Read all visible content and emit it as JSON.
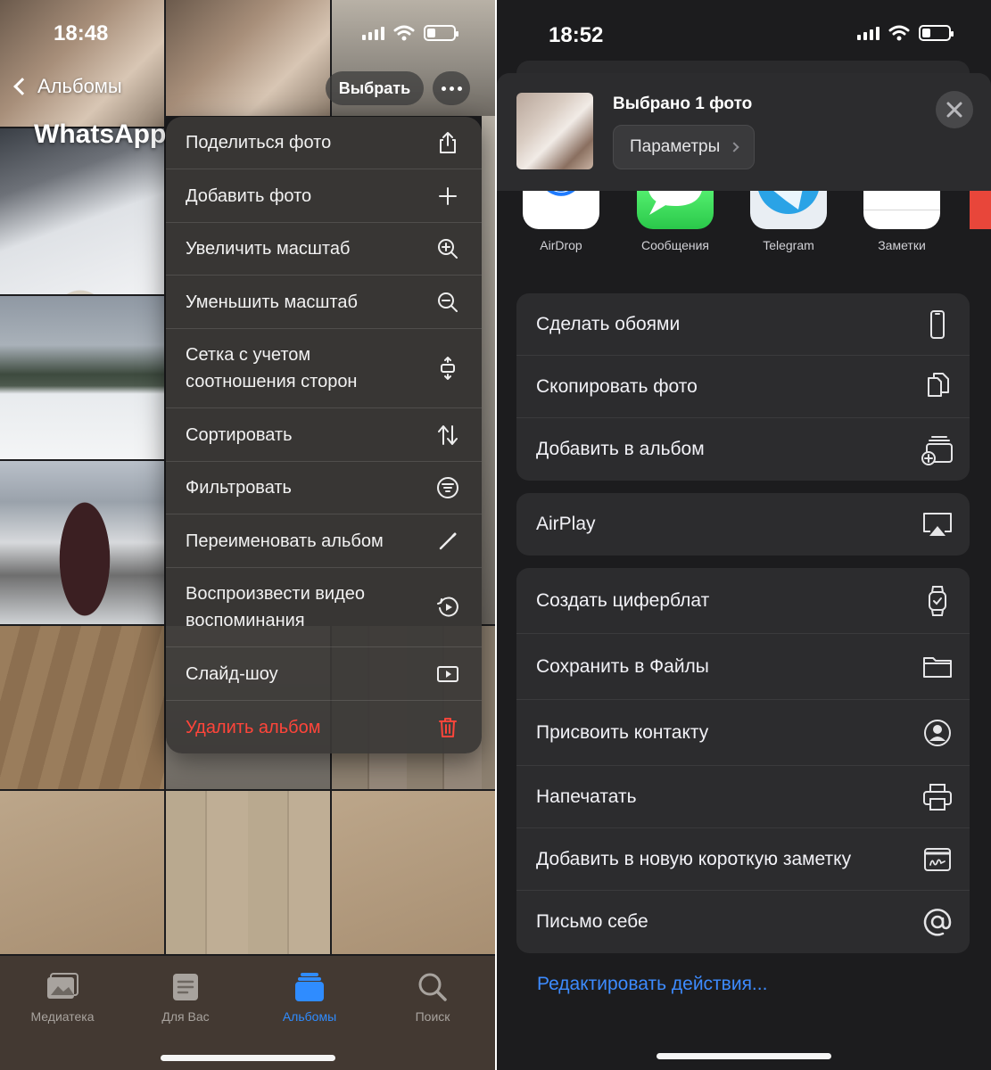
{
  "left": {
    "status": {
      "time": "18:48"
    },
    "nav": {
      "back_label": "Альбомы",
      "select_label": "Выбрать"
    },
    "album_title": "WhatsApp",
    "menu": [
      {
        "label": "Поделиться фото",
        "icon": "share-icon"
      },
      {
        "label": "Добавить фото",
        "icon": "plus-icon"
      },
      {
        "label": "Увеличить масштаб",
        "icon": "zoom-in-icon"
      },
      {
        "label": "Уменьшить масштаб",
        "icon": "zoom-out-icon"
      },
      {
        "label_line1": "Сетка с учетом",
        "label_line2": "соотношения сторон",
        "icon": "aspect-grid-icon"
      },
      {
        "label": "Сортировать",
        "icon": "sort-icon"
      },
      {
        "label": "Фильтровать",
        "icon": "filter-icon"
      },
      {
        "label": "Переименовать альбом",
        "icon": "pencil-icon"
      },
      {
        "label_line1": "Воспроизвести видео",
        "label_line2": "воспоминания",
        "icon": "memories-play-icon"
      },
      {
        "label": "Слайд-шоу",
        "icon": "slideshow-icon"
      },
      {
        "label": "Удалить альбом",
        "icon": "trash-icon",
        "color": "#ff453a"
      }
    ],
    "tabs": [
      {
        "label": "Медиатека",
        "icon": "library-icon",
        "active": false
      },
      {
        "label": "Для Вас",
        "icon": "for-you-icon",
        "active": false
      },
      {
        "label": "Альбомы",
        "icon": "albums-icon",
        "active": true
      },
      {
        "label": "Поиск",
        "icon": "search-icon",
        "active": false
      }
    ],
    "accent_color": "#2f8cff"
  },
  "right": {
    "status": {
      "time": "18:52"
    },
    "header": {
      "title": "Выбрано 1 фото",
      "params_label": "Параметры"
    },
    "apps": [
      {
        "label": "AirDrop",
        "icon": "airdrop-icon"
      },
      {
        "label": "Сообщения",
        "icon": "messages-icon"
      },
      {
        "label": "Telegram",
        "icon": "telegram-icon"
      },
      {
        "label": "Заметки",
        "icon": "notes-icon"
      }
    ],
    "group1": [
      {
        "label": "Сделать обоями",
        "icon": "iphone-icon"
      },
      {
        "label": "Скопировать фото",
        "icon": "copy-icon"
      },
      {
        "label": "Добавить в альбом",
        "icon": "add-to-album-icon"
      }
    ],
    "group2": [
      {
        "label": "AirPlay",
        "icon": "airplay-icon"
      }
    ],
    "group3": [
      {
        "label": "Создать циферблат",
        "icon": "watch-icon"
      },
      {
        "label": "Сохранить в Файлы",
        "icon": "folder-icon"
      },
      {
        "label": "Присвоить контакту",
        "icon": "contact-icon"
      },
      {
        "label": "Напечатать",
        "icon": "printer-icon"
      },
      {
        "label": "Добавить в новую короткую заметку",
        "icon": "quick-note-icon"
      },
      {
        "label": "Письмо себе",
        "icon": "at-sign-icon"
      }
    ],
    "edit_actions_label": "Редактировать действия...",
    "link_color": "#3d8bff"
  }
}
